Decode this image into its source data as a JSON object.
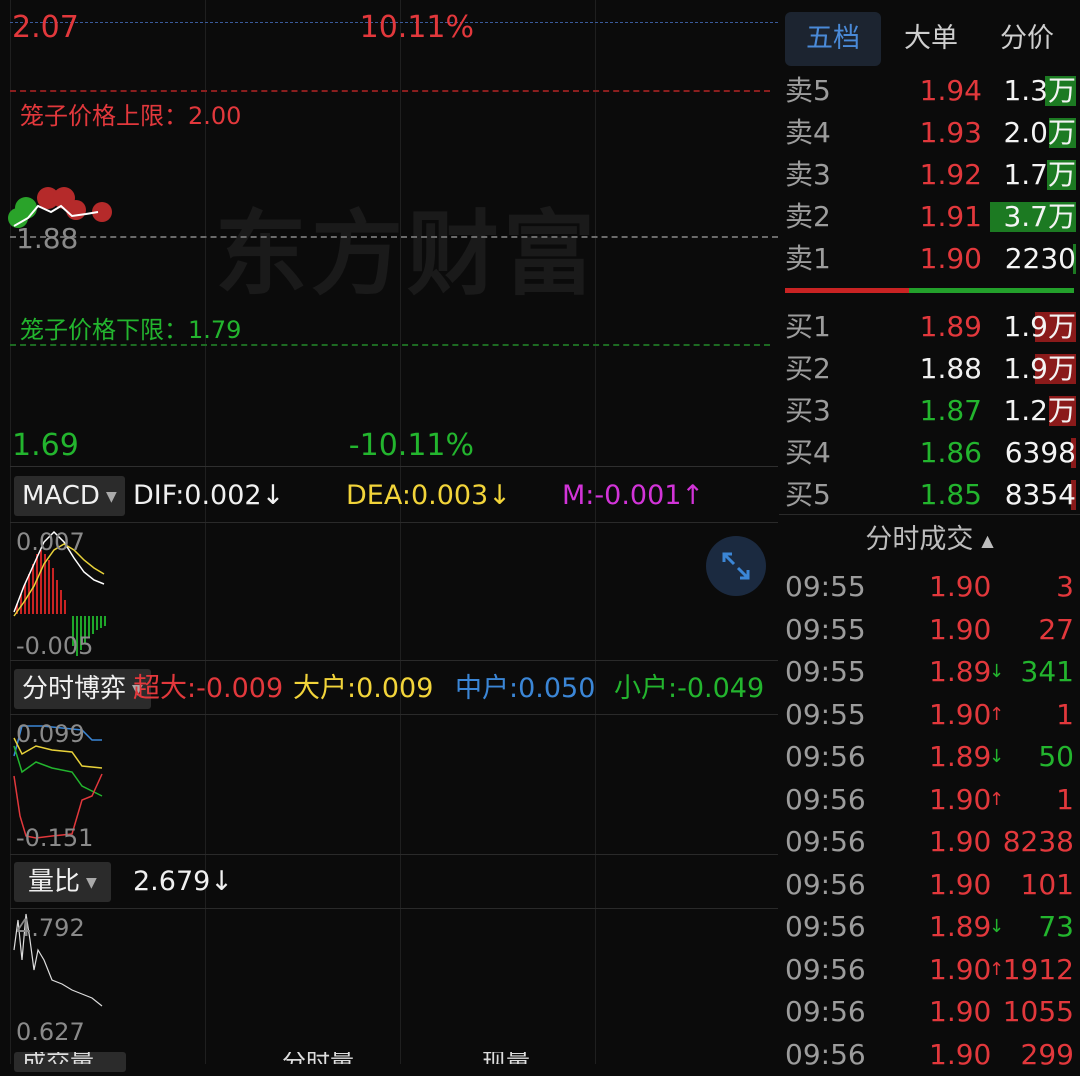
{
  "main_chart": {
    "high_price": "2.07",
    "high_pct": "10.11%",
    "low_price": "1.69",
    "low_pct": "-10.11%",
    "mid_price": "1.88",
    "cage_upper": "笼子价格上限：2.00",
    "cage_lower": "笼子价格下限：1.79",
    "watermark": "东方财富"
  },
  "macd": {
    "selector": "MACD",
    "dif": "DIF:0.002↓",
    "dea": "DEA:0.003↓",
    "m": "M:-0.001↑",
    "top": "0.007",
    "bottom": "-0.005"
  },
  "fenshi": {
    "selector": "分时博弈",
    "chaoda": "超大:-0.009",
    "dahu": "大户:0.009",
    "zhonghu": "中户:0.050",
    "xiaohu": "小户:-0.049",
    "top": "0.099",
    "bottom": "-0.151"
  },
  "liangbi": {
    "selector": "量比",
    "value": "2.679↓",
    "top": "4.792",
    "bottom": "0.627"
  },
  "bottom_bar": {
    "label1": "成交量",
    "label2": "分时量",
    "label3": "现量"
  },
  "tabs": [
    "五档",
    "大单",
    "分价"
  ],
  "sell": [
    {
      "label": "卖5",
      "price": "1.94",
      "vol": "1.3万",
      "bar": 0.35
    },
    {
      "label": "卖4",
      "price": "1.93",
      "vol": "2.0万",
      "bar": 0.3
    },
    {
      "label": "卖3",
      "price": "1.92",
      "vol": "1.7万",
      "bar": 0.32
    },
    {
      "label": "卖2",
      "price": "1.91",
      "vol": "3.7万",
      "bar": 0.95
    },
    {
      "label": "卖1",
      "price": "1.90",
      "vol": "2230",
      "bar": 0.03
    }
  ],
  "buy": [
    {
      "label": "买1",
      "price": "1.89",
      "vol": "1.9万",
      "bar": 0.45
    },
    {
      "label": "买2",
      "price": "1.88",
      "vol": "1.9万",
      "bar": 0.45
    },
    {
      "label": "买3",
      "price": "1.87",
      "vol": "1.2万",
      "bar": 0.3
    },
    {
      "label": "买4",
      "price": "1.86",
      "vol": "6398",
      "bar": 0.05
    },
    {
      "label": "买5",
      "price": "1.85",
      "vol": "8354",
      "bar": 0.06
    }
  ],
  "trades_header": "分时成交",
  "trades": [
    {
      "time": "09:55",
      "price": "1.90",
      "arrow": "",
      "vol": "3",
      "pc": "red",
      "vc": "red"
    },
    {
      "time": "09:55",
      "price": "1.90",
      "arrow": "",
      "vol": "27",
      "pc": "red",
      "vc": "red"
    },
    {
      "time": "09:55",
      "price": "1.89",
      "arrow": "↓",
      "vol": "341",
      "pc": "red",
      "vc": "green"
    },
    {
      "time": "09:55",
      "price": "1.90",
      "arrow": "↑",
      "vol": "1",
      "pc": "red",
      "vc": "red"
    },
    {
      "time": "09:56",
      "price": "1.89",
      "arrow": "↓",
      "vol": "50",
      "pc": "red",
      "vc": "green"
    },
    {
      "time": "09:56",
      "price": "1.90",
      "arrow": "↑",
      "vol": "1",
      "pc": "red",
      "vc": "red"
    },
    {
      "time": "09:56",
      "price": "1.90",
      "arrow": "",
      "vol": "8238",
      "pc": "red",
      "vc": "red"
    },
    {
      "time": "09:56",
      "price": "1.90",
      "arrow": "",
      "vol": "101",
      "pc": "red",
      "vc": "red"
    },
    {
      "time": "09:56",
      "price": "1.89",
      "arrow": "↓",
      "vol": "73",
      "pc": "red",
      "vc": "green"
    },
    {
      "time": "09:56",
      "price": "1.90",
      "arrow": "↑",
      "vol": "1912",
      "pc": "red",
      "vc": "red"
    },
    {
      "time": "09:56",
      "price": "1.90",
      "arrow": "",
      "vol": "1055",
      "pc": "red",
      "vc": "red"
    },
    {
      "time": "09:56",
      "price": "1.90",
      "arrow": "",
      "vol": "299",
      "pc": "red",
      "vc": "red"
    }
  ],
  "colors": {
    "up": "#e2383c",
    "down": "#23b52e",
    "accent": "#4a8ad8"
  }
}
